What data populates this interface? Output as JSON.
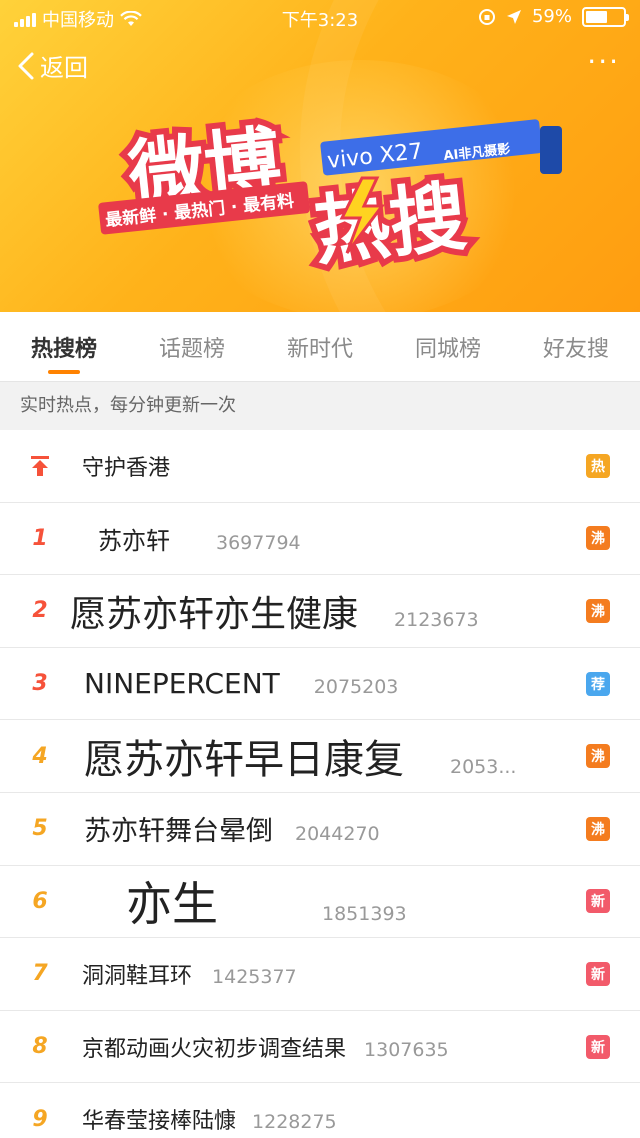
{
  "status_bar": {
    "carrier": "中国移动",
    "time": "下午3:23",
    "battery_percent": "59%",
    "battery_level": 0.59
  },
  "nav": {
    "back_label": "返回",
    "more_label": "···"
  },
  "banner": {
    "title_left": "微博",
    "title_right": "热搜",
    "slogan": "最新鲜 · 最热门 · 最有料",
    "sponsor_brand": "vivo X27",
    "sponsor_tag": "AI非凡摄影"
  },
  "tabs": [
    {
      "label": "热搜榜",
      "active": true
    },
    {
      "label": "话题榜",
      "active": false
    },
    {
      "label": "新时代",
      "active": false
    },
    {
      "label": "同城榜",
      "active": false
    },
    {
      "label": "好友搜",
      "active": false
    }
  ],
  "subheader": "实时热点，每分钟更新一次",
  "list": [
    {
      "rank": "",
      "pinned": true,
      "title": "守护香港",
      "count": "",
      "badge": "热",
      "badge_color": "#f5a623"
    },
    {
      "rank": "1",
      "title": "苏亦轩",
      "count": "3697794",
      "badge": "沸",
      "badge_color": "#f47c1f"
    },
    {
      "rank": "2",
      "title": "愿苏亦轩亦生健康",
      "count": "2123673",
      "badge": "沸",
      "badge_color": "#f47c1f"
    },
    {
      "rank": "3",
      "title": "NINEPERCENT",
      "count": "2075203",
      "badge": "荐",
      "badge_color": "#4aa7ee"
    },
    {
      "rank": "4",
      "title": "愿苏亦轩早日康复",
      "count": "2053...",
      "badge": "沸",
      "badge_color": "#f47c1f"
    },
    {
      "rank": "5",
      "title": "苏亦轩舞台晕倒",
      "count": "2044270",
      "badge": "沸",
      "badge_color": "#f47c1f"
    },
    {
      "rank": "6",
      "title": "亦生",
      "count": "1851393",
      "badge": "新",
      "badge_color": "#f25a6a"
    },
    {
      "rank": "7",
      "title": "洞洞鞋耳环",
      "count": "1425377",
      "badge": "新",
      "badge_color": "#f25a6a"
    },
    {
      "rank": "8",
      "title": "京都动画火灾初步调查结果",
      "count": "1307635",
      "badge": "新",
      "badge_color": "#f25a6a"
    },
    {
      "rank": "9",
      "title": "华春莹接棒陆慷",
      "count": "1228275",
      "badge": "",
      "badge_color": ""
    }
  ]
}
